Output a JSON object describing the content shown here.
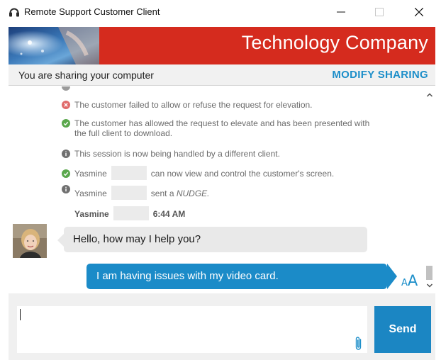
{
  "window": {
    "title": "Remote Support Customer Client",
    "icon": "headset-icon",
    "controls": [
      "minimize-icon",
      "maximize-icon",
      "close-icon"
    ]
  },
  "banner": {
    "title": "Technology Company",
    "background_color": "#d52b1e"
  },
  "sharing": {
    "status_text": "You are sharing your computer",
    "action_label": "MODIFY SHARING",
    "action_color": "#1c8ec9"
  },
  "events": [
    {
      "icon": "warning-x-icon",
      "color": "#e06b6b",
      "text": "The customer failed to allow or refuse the request for elevation."
    },
    {
      "icon": "success-check-icon",
      "color": "#5aa84c",
      "text": "The customer has allowed the request to elevate and has been presented with the full client to download."
    },
    {
      "icon": "info-icon",
      "color": "#707070",
      "text": "This session is now being handled by a different client."
    },
    {
      "icon": "success-check-icon",
      "color": "#5aa84c",
      "name": "Yasmine",
      "text": "can now view and control the customer's screen."
    },
    {
      "icon": "info-icon",
      "color": "#707070",
      "name": "Yasmine",
      "text_before": "sent a",
      "text_emphasis": "NUDGE."
    }
  ],
  "message_header": {
    "name": "Yasmine",
    "time": "6:44 AM"
  },
  "messages": {
    "incoming": "Hello, how may I help you?",
    "outgoing": "I am having issues with my video card."
  },
  "font_size_button": {
    "small": "A",
    "large": "A"
  },
  "composer": {
    "value": "",
    "send_label": "Send",
    "send_color": "#1b86c3"
  }
}
